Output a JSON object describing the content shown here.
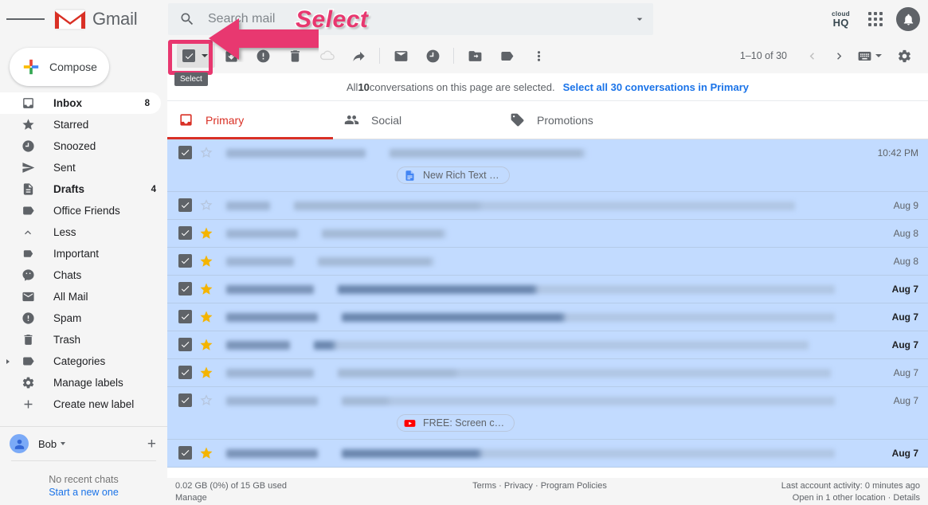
{
  "app": {
    "brand": "Gmail"
  },
  "search": {
    "placeholder": "Search mail",
    "value": ""
  },
  "topright": {
    "cloudhq_line1": "cloud",
    "cloudhq_line2": "HQ"
  },
  "compose": {
    "label": "Compose"
  },
  "sidebar": {
    "items": [
      {
        "label": "Inbox",
        "count": "8",
        "icon": "inbox-icon",
        "active": true
      },
      {
        "label": "Starred",
        "count": "",
        "icon": "star-icon"
      },
      {
        "label": "Snoozed",
        "count": "",
        "icon": "clock-icon"
      },
      {
        "label": "Sent",
        "count": "",
        "icon": "send-icon"
      },
      {
        "label": "Drafts",
        "count": "4",
        "icon": "draft-icon",
        "bold": true
      },
      {
        "label": "Office Friends",
        "count": "",
        "icon": "label-icon"
      },
      {
        "label": "Less",
        "count": "",
        "icon": "chevron-up-icon"
      },
      {
        "label": "Important",
        "count": "",
        "icon": "important-icon"
      },
      {
        "label": "Chats",
        "count": "",
        "icon": "chat-icon"
      },
      {
        "label": "All Mail",
        "count": "",
        "icon": "mail-icon"
      },
      {
        "label": "Spam",
        "count": "",
        "icon": "spam-icon"
      },
      {
        "label": "Trash",
        "count": "",
        "icon": "trash-icon"
      },
      {
        "label": "Categories",
        "count": "",
        "icon": "label-icon",
        "expander": true
      },
      {
        "label": "Manage labels",
        "count": "",
        "icon": "gear-icon"
      },
      {
        "label": "Create new label",
        "count": "",
        "icon": "plus-icon"
      }
    ]
  },
  "chat": {
    "user_name": "Bob",
    "no_recent": "No recent chats",
    "start_new": "Start a new one"
  },
  "toolbar": {
    "select_tooltip": "Select",
    "pager_text": "1–10 of 30",
    "buttons": [
      "archive-icon",
      "report-spam-icon",
      "delete-icon",
      "cloudhq-cloud-icon",
      "forward-icon",
      "mark-unread-icon",
      "snooze-icon",
      "move-to-icon",
      "labels-icon",
      "more-icon"
    ]
  },
  "select_banner": {
    "prefix": "All ",
    "count": "10",
    "middle": " conversations on this page are selected.",
    "link": "Select all 30 conversations in Primary"
  },
  "tabs": [
    {
      "label": "Primary",
      "icon": "inbox-tab-icon",
      "active": true
    },
    {
      "label": "Social",
      "icon": "people-icon",
      "active": false
    },
    {
      "label": "Promotions",
      "icon": "tag-icon",
      "active": false
    }
  ],
  "emails": [
    {
      "date": "10:42 PM",
      "starred": false,
      "unread": false,
      "checked": true,
      "sender_w": 175,
      "subject_w": 240,
      "snippet_w": 0,
      "chip": {
        "label": "New Rich Text …",
        "icon": "google-docs-icon"
      }
    },
    {
      "date": "Aug 9",
      "starred": false,
      "unread": false,
      "checked": true,
      "sender_w": 55,
      "subject_w": 230,
      "snippet_w": 390
    },
    {
      "date": "Aug 8",
      "starred": true,
      "unread": false,
      "checked": true,
      "sender_w": 90,
      "subject_w": 150,
      "snippet_w": 0
    },
    {
      "date": "Aug 8",
      "starred": true,
      "unread": false,
      "checked": true,
      "sender_w": 85,
      "subject_w": 140,
      "snippet_w": 0
    },
    {
      "date": "Aug 7",
      "starred": true,
      "unread": true,
      "checked": true,
      "sender_w": 110,
      "subject_w": 245,
      "snippet_w": 370
    },
    {
      "date": "Aug 7",
      "starred": true,
      "unread": true,
      "checked": true,
      "sender_w": 115,
      "subject_w": 275,
      "snippet_w": 335
    },
    {
      "date": "Aug 7",
      "starred": true,
      "unread": true,
      "checked": true,
      "sender_w": 80,
      "subject_w": 22,
      "snippet_w": 590
    },
    {
      "date": "Aug 7",
      "starred": true,
      "unread": false,
      "checked": true,
      "sender_w": 110,
      "subject_w": 145,
      "snippet_w": 465
    },
    {
      "date": "Aug 7",
      "starred": false,
      "unread": false,
      "checked": true,
      "sender_w": 115,
      "subject_w": 55,
      "snippet_w": 555,
      "chip": {
        "label": "FREE: Screen c…",
        "icon": "youtube-icon"
      }
    },
    {
      "date": "Aug 7",
      "starred": true,
      "unread": true,
      "checked": true,
      "sender_w": 115,
      "subject_w": 170,
      "snippet_w": 440
    }
  ],
  "footer": {
    "storage": "0.02 GB (0%) of 15 GB used",
    "manage": "Manage",
    "terms": "Terms",
    "privacy": "Privacy",
    "policies": "Program Policies",
    "activity": "Last account activity: 0 minutes ago",
    "open_location": "Open in 1 other location",
    "details": "Details"
  },
  "annotation": {
    "text": "Select",
    "color": "#e8376f"
  }
}
